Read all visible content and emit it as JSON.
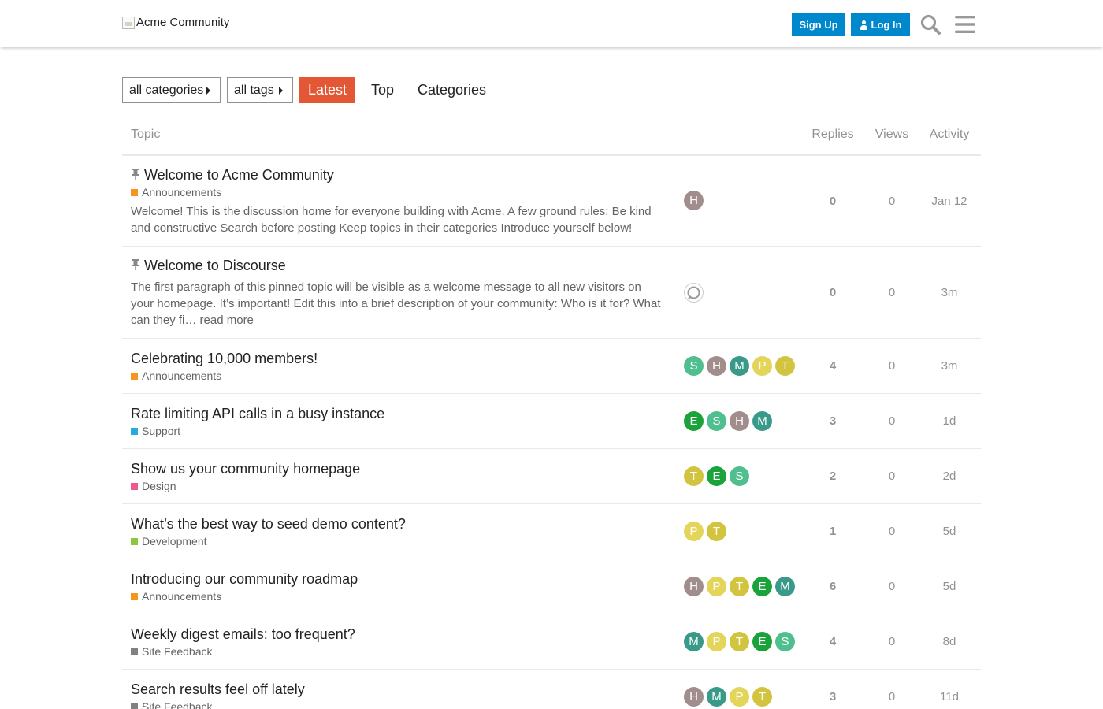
{
  "header": {
    "logo_alt": "Acme Community",
    "signup_label": "Sign Up",
    "login_label": "Log In"
  },
  "nav": {
    "categories_dropdown": "all categories",
    "tags_dropdown": "all tags",
    "tabs": [
      {
        "label": "Latest",
        "active": true
      },
      {
        "label": "Top",
        "active": false
      },
      {
        "label": "Categories",
        "active": false
      }
    ]
  },
  "colors": {
    "accent": "#e45735",
    "primary_button": "#0088cc",
    "muted_text": "#919191"
  },
  "table": {
    "columns": {
      "topic": "Topic",
      "replies": "Replies",
      "views": "Views",
      "activity": "Activity"
    },
    "topics": [
      {
        "title": "Welcome to Acme Community",
        "pinned": true,
        "category": "Announcements",
        "category_color": "#f7941d",
        "excerpt": "Welcome! This is the discussion home for everyone building with Acme. A few ground rules: Be kind and constructive Search before posting Keep topics in their categories Introduce yourself below!",
        "posters": [
          {
            "letter": "H",
            "color": "#a18e8c"
          }
        ],
        "replies": "0",
        "views": "0",
        "activity": "Jan 12"
      },
      {
        "title": "Welcome to Discourse",
        "pinned": true,
        "category": "",
        "category_color": "",
        "excerpt": "The first paragraph of this pinned topic will be visible as a welcome message to all new visitors on your homepage. It’s important! Edit this into a brief description of your community: Who is it for? What can they fi… read more",
        "posters": [
          {
            "system": true
          }
        ],
        "replies": "0",
        "views": "0",
        "activity": "3m"
      },
      {
        "title": "Celebrating 10,000 members!",
        "pinned": false,
        "category": "Announcements",
        "category_color": "#f7941d",
        "excerpt": "",
        "posters": [
          {
            "letter": "S",
            "color": "#4fbf8f"
          },
          {
            "letter": "H",
            "color": "#a18e8c"
          },
          {
            "letter": "M",
            "color": "#3a9a8a"
          },
          {
            "letter": "P",
            "color": "#e3d45a"
          },
          {
            "letter": "T",
            "color": "#d3c43f"
          }
        ],
        "replies": "4",
        "views": "0",
        "activity": "3m"
      },
      {
        "title": "Rate limiting API calls in a busy instance",
        "pinned": false,
        "category": "Support",
        "category_color": "#25aae2",
        "excerpt": "",
        "posters": [
          {
            "letter": "E",
            "color": "#1aa33a"
          },
          {
            "letter": "S",
            "color": "#4fbf8f"
          },
          {
            "letter": "H",
            "color": "#a18e8c"
          },
          {
            "letter": "M",
            "color": "#3a9a8a"
          }
        ],
        "replies": "3",
        "views": "0",
        "activity": "1d"
      },
      {
        "title": "Show us your community homepage",
        "pinned": false,
        "category": "Design",
        "category_color": "#ea5a90",
        "excerpt": "",
        "posters": [
          {
            "letter": "T",
            "color": "#d3c43f"
          },
          {
            "letter": "E",
            "color": "#1aa33a"
          },
          {
            "letter": "S",
            "color": "#4fbf8f"
          }
        ],
        "replies": "2",
        "views": "0",
        "activity": "2d"
      },
      {
        "title": "What’s the best way to seed demo content?",
        "pinned": false,
        "category": "Development",
        "category_color": "#8dc63f",
        "excerpt": "",
        "posters": [
          {
            "letter": "P",
            "color": "#e3d45a"
          },
          {
            "letter": "T",
            "color": "#d3c43f"
          }
        ],
        "replies": "1",
        "views": "0",
        "activity": "5d"
      },
      {
        "title": "Introducing our community roadmap",
        "pinned": false,
        "category": "Announcements",
        "category_color": "#f7941d",
        "excerpt": "",
        "posters": [
          {
            "letter": "H",
            "color": "#a18e8c"
          },
          {
            "letter": "P",
            "color": "#e3d45a"
          },
          {
            "letter": "T",
            "color": "#d3c43f"
          },
          {
            "letter": "E",
            "color": "#1aa33a"
          },
          {
            "letter": "M",
            "color": "#3a9a8a"
          }
        ],
        "replies": "6",
        "views": "0",
        "activity": "5d"
      },
      {
        "title": "Weekly digest emails: too frequent?",
        "pinned": false,
        "category": "Site Feedback",
        "category_color": "#808281",
        "excerpt": "",
        "posters": [
          {
            "letter": "M",
            "color": "#3a9a8a"
          },
          {
            "letter": "P",
            "color": "#e3d45a"
          },
          {
            "letter": "T",
            "color": "#d3c43f"
          },
          {
            "letter": "E",
            "color": "#1aa33a"
          },
          {
            "letter": "S",
            "color": "#4fbf8f"
          }
        ],
        "replies": "4",
        "views": "0",
        "activity": "8d"
      },
      {
        "title": "Search results feel off lately",
        "pinned": false,
        "category": "Site Feedback",
        "category_color": "#808281",
        "excerpt": "",
        "posters": [
          {
            "letter": "H",
            "color": "#a18e8c"
          },
          {
            "letter": "M",
            "color": "#3a9a8a"
          },
          {
            "letter": "P",
            "color": "#e3d45a"
          },
          {
            "letter": "T",
            "color": "#d3c43f"
          }
        ],
        "replies": "3",
        "views": "0",
        "activity": "11d"
      }
    ]
  }
}
